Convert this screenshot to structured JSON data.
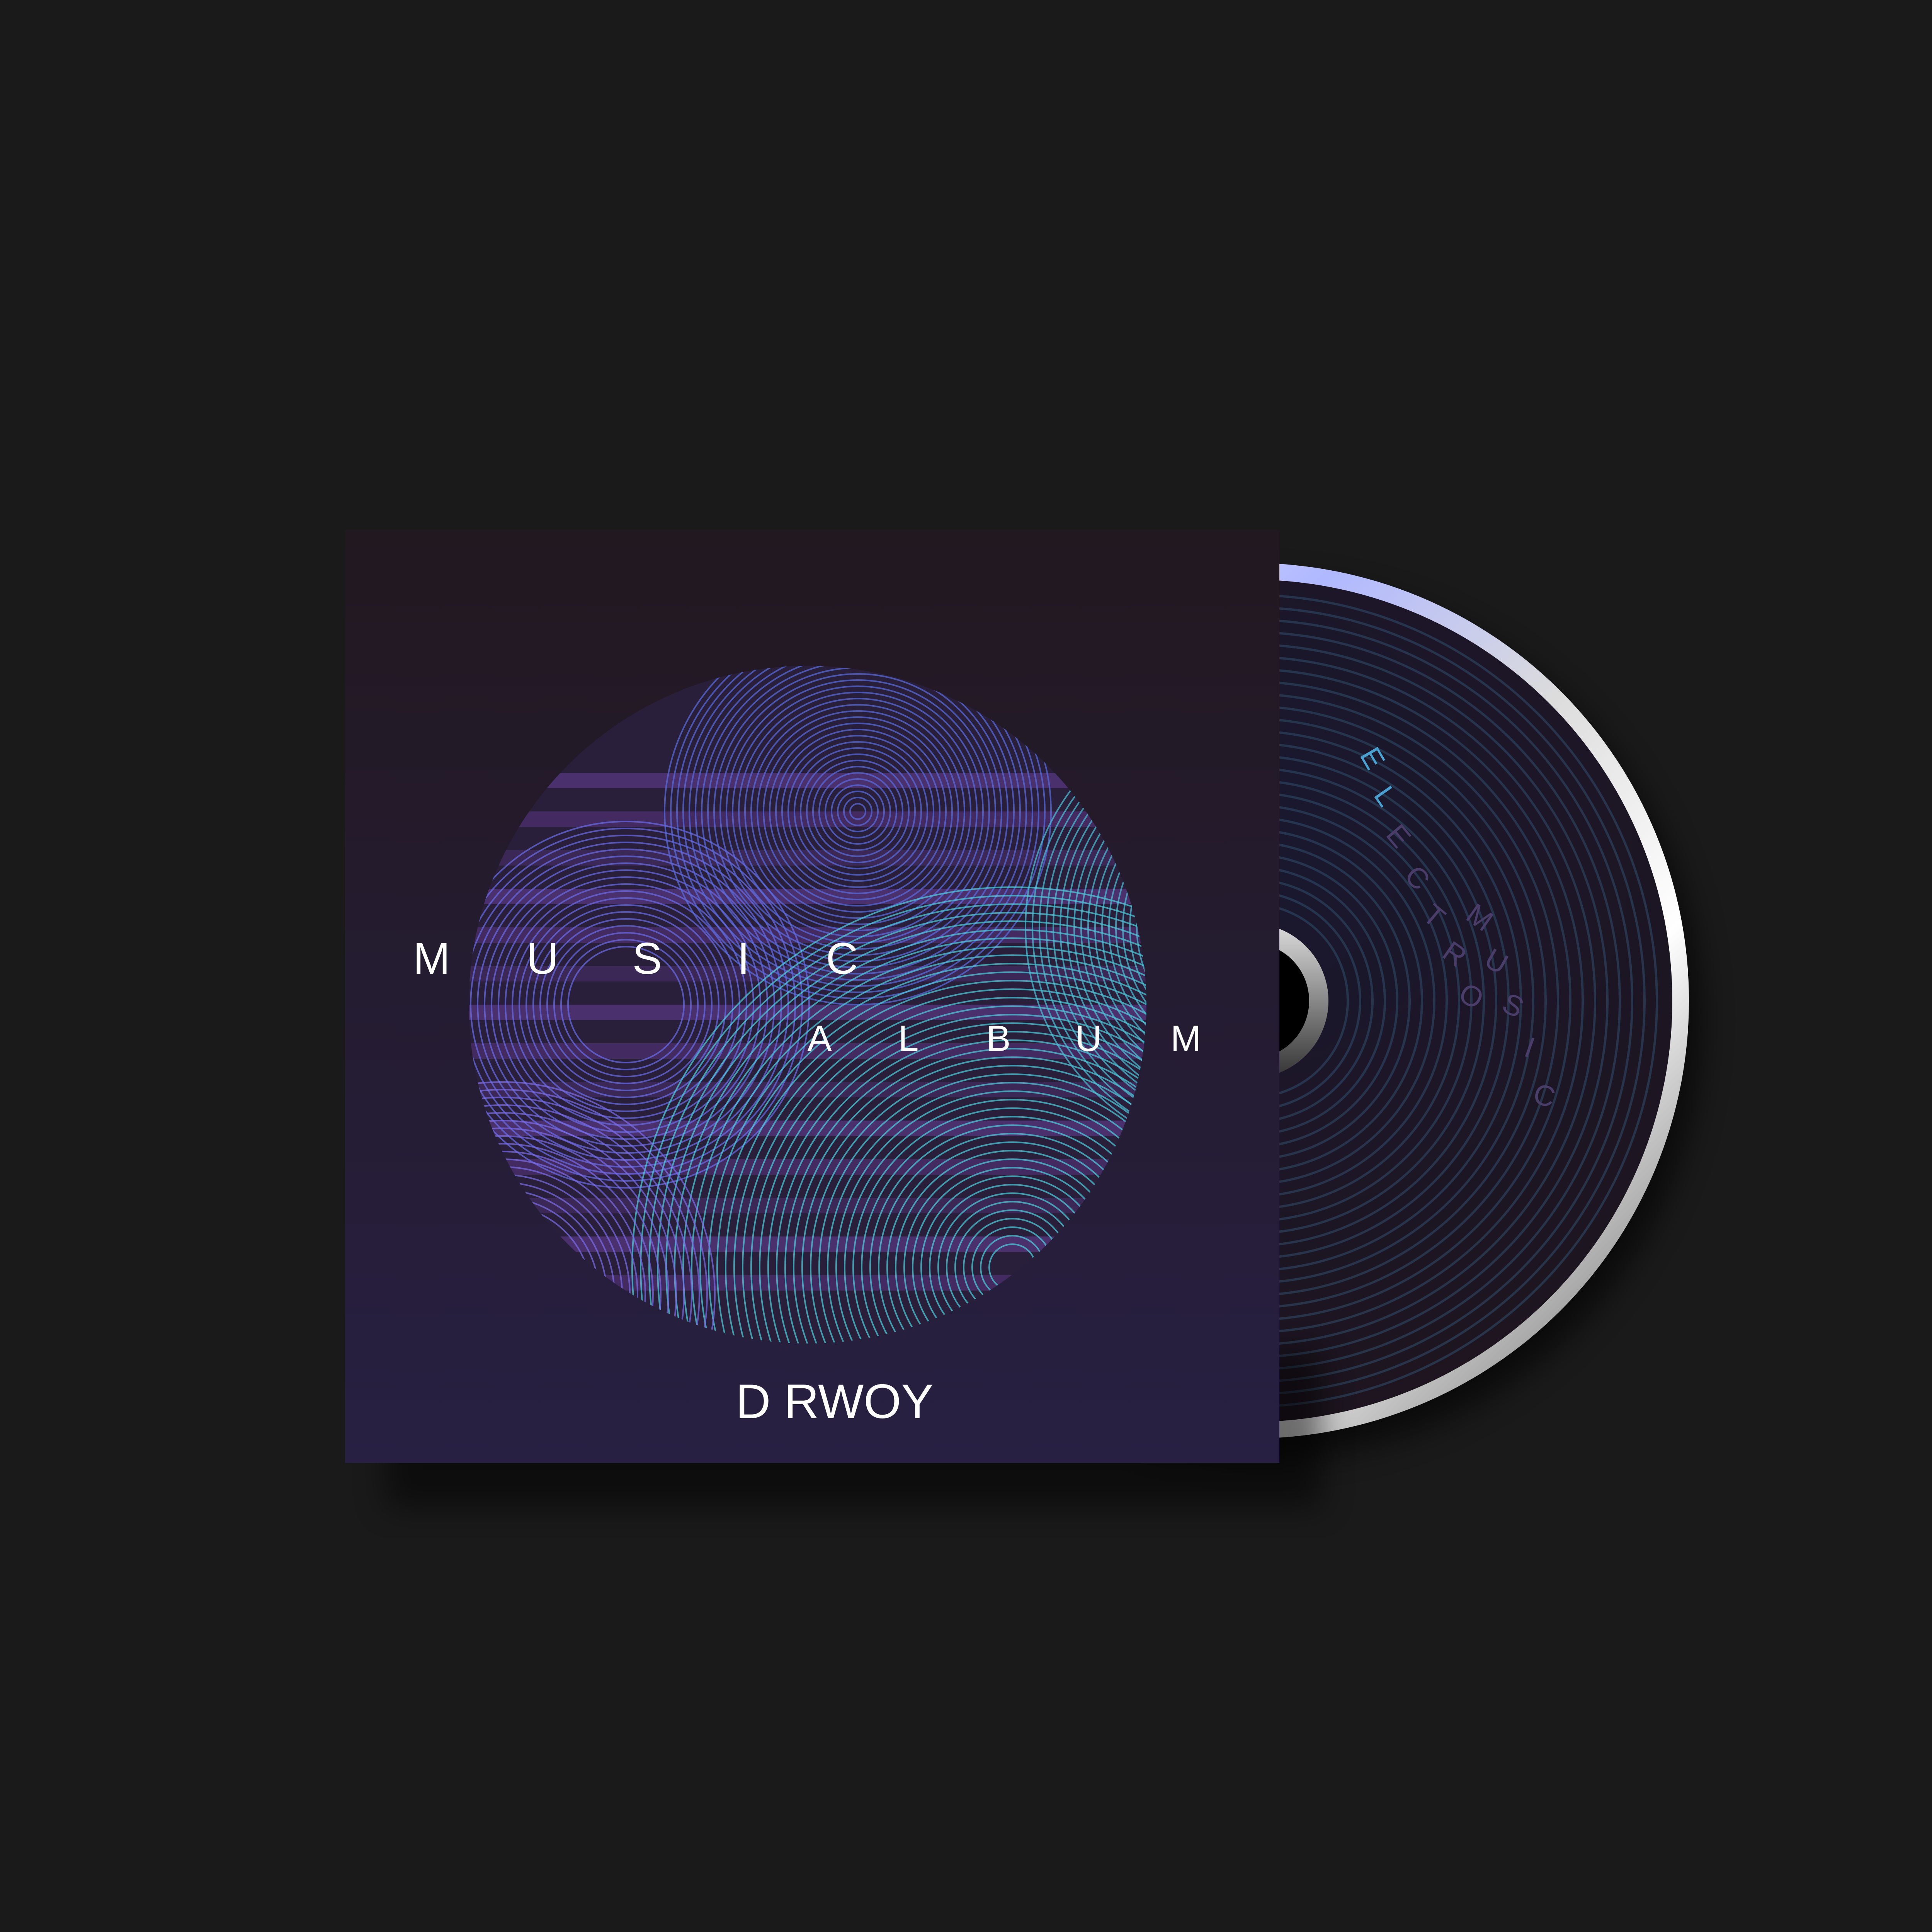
{
  "cover": {
    "title_word_1": [
      "M",
      "U",
      "S",
      "I",
      "C"
    ],
    "title_word_2": [
      "A",
      "L",
      "B",
      "U",
      "M"
    ],
    "artist": "D RWOY"
  },
  "disc": {
    "label_word_1": [
      "E",
      "L",
      "E",
      "C",
      "T",
      "R",
      "O"
    ],
    "label_word_2": [
      "M",
      "U",
      "S",
      "I",
      "C"
    ]
  },
  "colors": {
    "background": "#1a1a1a",
    "cover_top": "#221820",
    "cover_bottom": "#272042",
    "accent_purple": "#8a4fd0",
    "accent_blue": "#5a6de0",
    "accent_cyan": "#4fd0e0"
  }
}
